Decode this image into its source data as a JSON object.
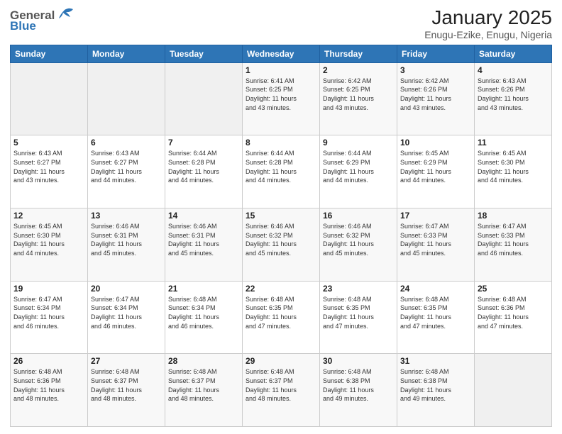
{
  "header": {
    "logo_general": "General",
    "logo_blue": "Blue",
    "title": "January 2025",
    "subtitle": "Enugu-Ezike, Enugu, Nigeria"
  },
  "weekdays": [
    "Sunday",
    "Monday",
    "Tuesday",
    "Wednesday",
    "Thursday",
    "Friday",
    "Saturday"
  ],
  "weeks": [
    [
      {
        "day": "",
        "info": ""
      },
      {
        "day": "",
        "info": ""
      },
      {
        "day": "",
        "info": ""
      },
      {
        "day": "1",
        "info": "Sunrise: 6:41 AM\nSunset: 6:25 PM\nDaylight: 11 hours\nand 43 minutes."
      },
      {
        "day": "2",
        "info": "Sunrise: 6:42 AM\nSunset: 6:25 PM\nDaylight: 11 hours\nand 43 minutes."
      },
      {
        "day": "3",
        "info": "Sunrise: 6:42 AM\nSunset: 6:26 PM\nDaylight: 11 hours\nand 43 minutes."
      },
      {
        "day": "4",
        "info": "Sunrise: 6:43 AM\nSunset: 6:26 PM\nDaylight: 11 hours\nand 43 minutes."
      }
    ],
    [
      {
        "day": "5",
        "info": "Sunrise: 6:43 AM\nSunset: 6:27 PM\nDaylight: 11 hours\nand 43 minutes."
      },
      {
        "day": "6",
        "info": "Sunrise: 6:43 AM\nSunset: 6:27 PM\nDaylight: 11 hours\nand 44 minutes."
      },
      {
        "day": "7",
        "info": "Sunrise: 6:44 AM\nSunset: 6:28 PM\nDaylight: 11 hours\nand 44 minutes."
      },
      {
        "day": "8",
        "info": "Sunrise: 6:44 AM\nSunset: 6:28 PM\nDaylight: 11 hours\nand 44 minutes."
      },
      {
        "day": "9",
        "info": "Sunrise: 6:44 AM\nSunset: 6:29 PM\nDaylight: 11 hours\nand 44 minutes."
      },
      {
        "day": "10",
        "info": "Sunrise: 6:45 AM\nSunset: 6:29 PM\nDaylight: 11 hours\nand 44 minutes."
      },
      {
        "day": "11",
        "info": "Sunrise: 6:45 AM\nSunset: 6:30 PM\nDaylight: 11 hours\nand 44 minutes."
      }
    ],
    [
      {
        "day": "12",
        "info": "Sunrise: 6:45 AM\nSunset: 6:30 PM\nDaylight: 11 hours\nand 44 minutes."
      },
      {
        "day": "13",
        "info": "Sunrise: 6:46 AM\nSunset: 6:31 PM\nDaylight: 11 hours\nand 45 minutes."
      },
      {
        "day": "14",
        "info": "Sunrise: 6:46 AM\nSunset: 6:31 PM\nDaylight: 11 hours\nand 45 minutes."
      },
      {
        "day": "15",
        "info": "Sunrise: 6:46 AM\nSunset: 6:32 PM\nDaylight: 11 hours\nand 45 minutes."
      },
      {
        "day": "16",
        "info": "Sunrise: 6:46 AM\nSunset: 6:32 PM\nDaylight: 11 hours\nand 45 minutes."
      },
      {
        "day": "17",
        "info": "Sunrise: 6:47 AM\nSunset: 6:33 PM\nDaylight: 11 hours\nand 45 minutes."
      },
      {
        "day": "18",
        "info": "Sunrise: 6:47 AM\nSunset: 6:33 PM\nDaylight: 11 hours\nand 46 minutes."
      }
    ],
    [
      {
        "day": "19",
        "info": "Sunrise: 6:47 AM\nSunset: 6:34 PM\nDaylight: 11 hours\nand 46 minutes."
      },
      {
        "day": "20",
        "info": "Sunrise: 6:47 AM\nSunset: 6:34 PM\nDaylight: 11 hours\nand 46 minutes."
      },
      {
        "day": "21",
        "info": "Sunrise: 6:48 AM\nSunset: 6:34 PM\nDaylight: 11 hours\nand 46 minutes."
      },
      {
        "day": "22",
        "info": "Sunrise: 6:48 AM\nSunset: 6:35 PM\nDaylight: 11 hours\nand 47 minutes."
      },
      {
        "day": "23",
        "info": "Sunrise: 6:48 AM\nSunset: 6:35 PM\nDaylight: 11 hours\nand 47 minutes."
      },
      {
        "day": "24",
        "info": "Sunrise: 6:48 AM\nSunset: 6:35 PM\nDaylight: 11 hours\nand 47 minutes."
      },
      {
        "day": "25",
        "info": "Sunrise: 6:48 AM\nSunset: 6:36 PM\nDaylight: 11 hours\nand 47 minutes."
      }
    ],
    [
      {
        "day": "26",
        "info": "Sunrise: 6:48 AM\nSunset: 6:36 PM\nDaylight: 11 hours\nand 48 minutes."
      },
      {
        "day": "27",
        "info": "Sunrise: 6:48 AM\nSunset: 6:37 PM\nDaylight: 11 hours\nand 48 minutes."
      },
      {
        "day": "28",
        "info": "Sunrise: 6:48 AM\nSunset: 6:37 PM\nDaylight: 11 hours\nand 48 minutes."
      },
      {
        "day": "29",
        "info": "Sunrise: 6:48 AM\nSunset: 6:37 PM\nDaylight: 11 hours\nand 48 minutes."
      },
      {
        "day": "30",
        "info": "Sunrise: 6:48 AM\nSunset: 6:38 PM\nDaylight: 11 hours\nand 49 minutes."
      },
      {
        "day": "31",
        "info": "Sunrise: 6:48 AM\nSunset: 6:38 PM\nDaylight: 11 hours\nand 49 minutes."
      },
      {
        "day": "",
        "info": ""
      }
    ]
  ]
}
